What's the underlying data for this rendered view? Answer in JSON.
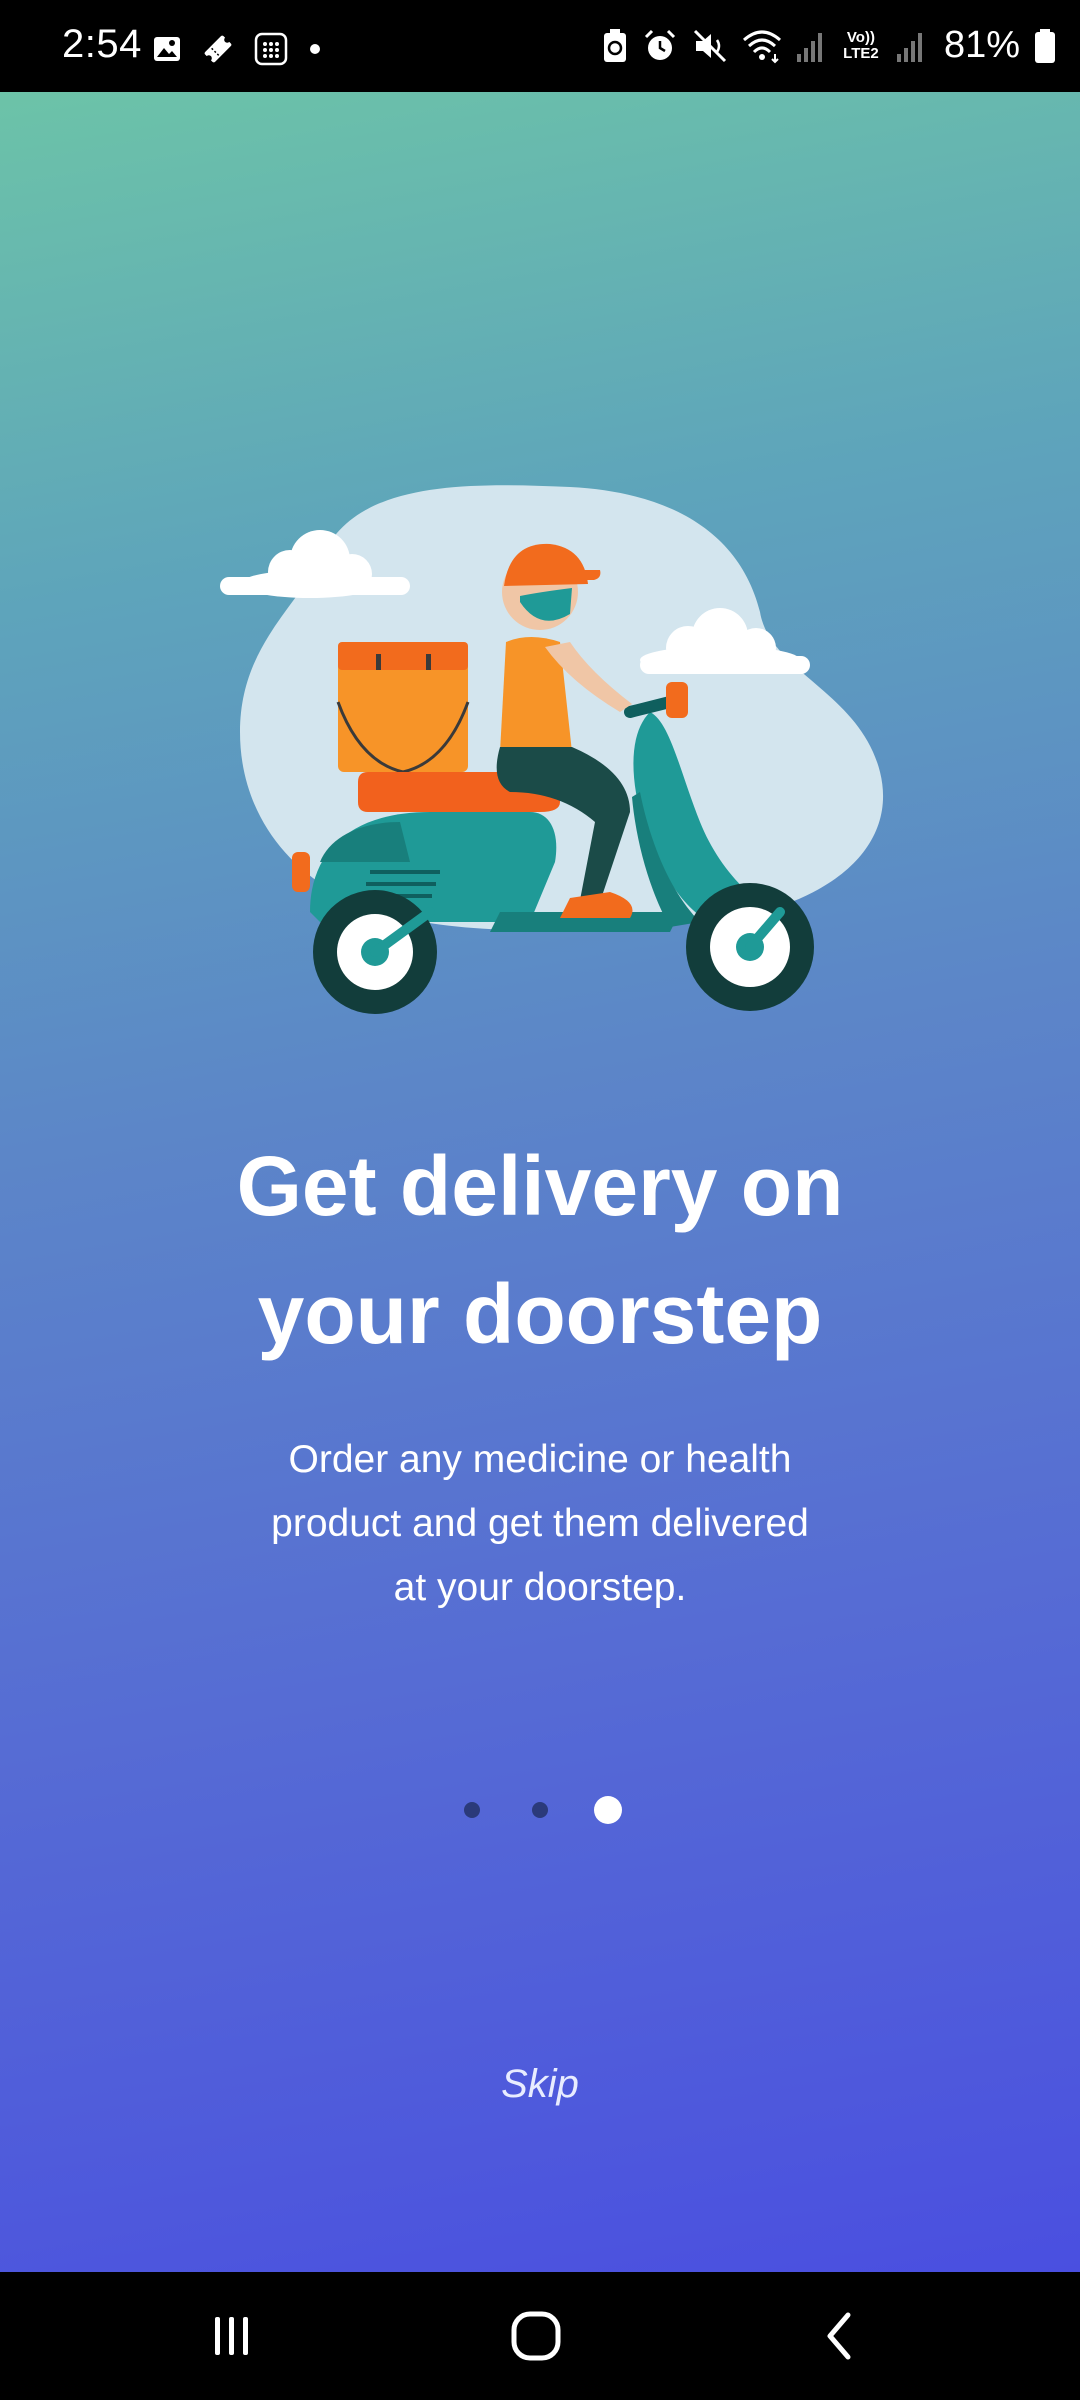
{
  "status_bar": {
    "time": "2:54",
    "battery_percent": "81%",
    "left_icons": [
      "gallery-icon",
      "ticket-icon",
      "calculator-icon",
      "dot-icon"
    ],
    "right_icons": [
      "battery-saver-icon",
      "alarm-icon",
      "mute-icon",
      "wifi-icon",
      "signal-icon",
      "volte-icon",
      "signal-icon",
      "battery-icon"
    ],
    "volte_label": "Vo)) LTE2"
  },
  "onboarding": {
    "headline_line1": "Get delivery on",
    "headline_line2": "your doorstep",
    "description_line1": "Order any medicine or health",
    "description_line2": "product and get them delivered",
    "description_line3": "at your doorstep.",
    "page_count": 3,
    "current_page": 3,
    "skip_label": "Skip"
  },
  "nav_bar": {
    "buttons": [
      "recents-icon",
      "home-icon",
      "back-icon"
    ]
  },
  "colors": {
    "gradient_top": "#6cc3a8",
    "gradient_bottom": "#4a4fe0",
    "dot_inactive": "#2b3a7a",
    "dot_active": "#ffffff"
  }
}
